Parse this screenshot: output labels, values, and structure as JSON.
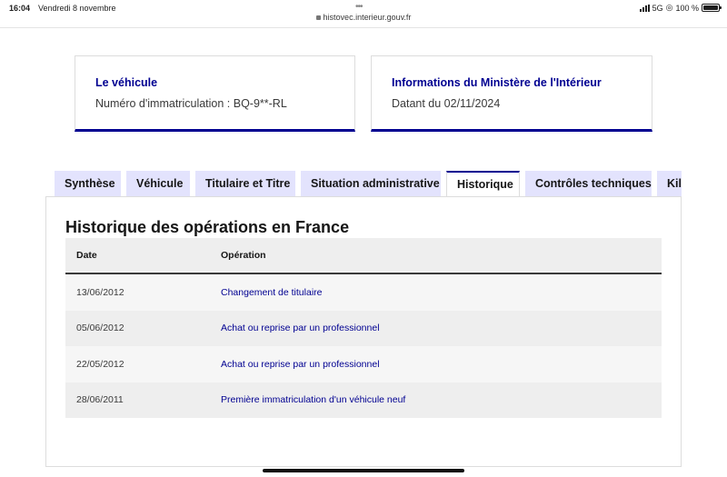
{
  "status_bar": {
    "time": "16:04",
    "date": "Vendredi 8 novembre",
    "url": "histovec.interieur.gouv.fr",
    "network": "5G",
    "battery_text": "100 %",
    "battery_level": 1.0,
    "icons": [
      "more-dots-icon",
      "lock-icon",
      "signal-icon",
      "location-icon",
      "battery-icon"
    ]
  },
  "cards": [
    {
      "title": "Le véhicule",
      "text": "Numéro d'immatriculation : BQ-9**-RL"
    },
    {
      "title": "Informations du Ministère de l'Intérieur",
      "text": "Datant du 02/11/2024"
    }
  ],
  "tabs": [
    {
      "label": "Synthèse",
      "active": false
    },
    {
      "label": "Véhicule",
      "active": false
    },
    {
      "label": "Titulaire et Titre",
      "active": false
    },
    {
      "label": "Situation administrative",
      "active": false
    },
    {
      "label": "Historique",
      "active": true
    },
    {
      "label": "Contrôles techniques",
      "active": false
    },
    {
      "label": "Kilométrage",
      "active": false
    }
  ],
  "section": {
    "title": "Historique des opérations en France",
    "columns": [
      "Date",
      "Opération"
    ],
    "rows": [
      {
        "date": "13/06/2012",
        "operation": "Changement de titulaire"
      },
      {
        "date": "05/06/2012",
        "operation": "Achat ou reprise par un professionnel"
      },
      {
        "date": "22/05/2012",
        "operation": "Achat ou reprise par un professionnel"
      },
      {
        "date": "28/06/2011",
        "operation": "Première immatriculation d'un véhicule neuf"
      }
    ]
  },
  "colors": {
    "accent": "#000091",
    "tab_background": "#e3e3fd",
    "row_light": "#f6f6f6",
    "row_dark": "#eeeeee"
  }
}
